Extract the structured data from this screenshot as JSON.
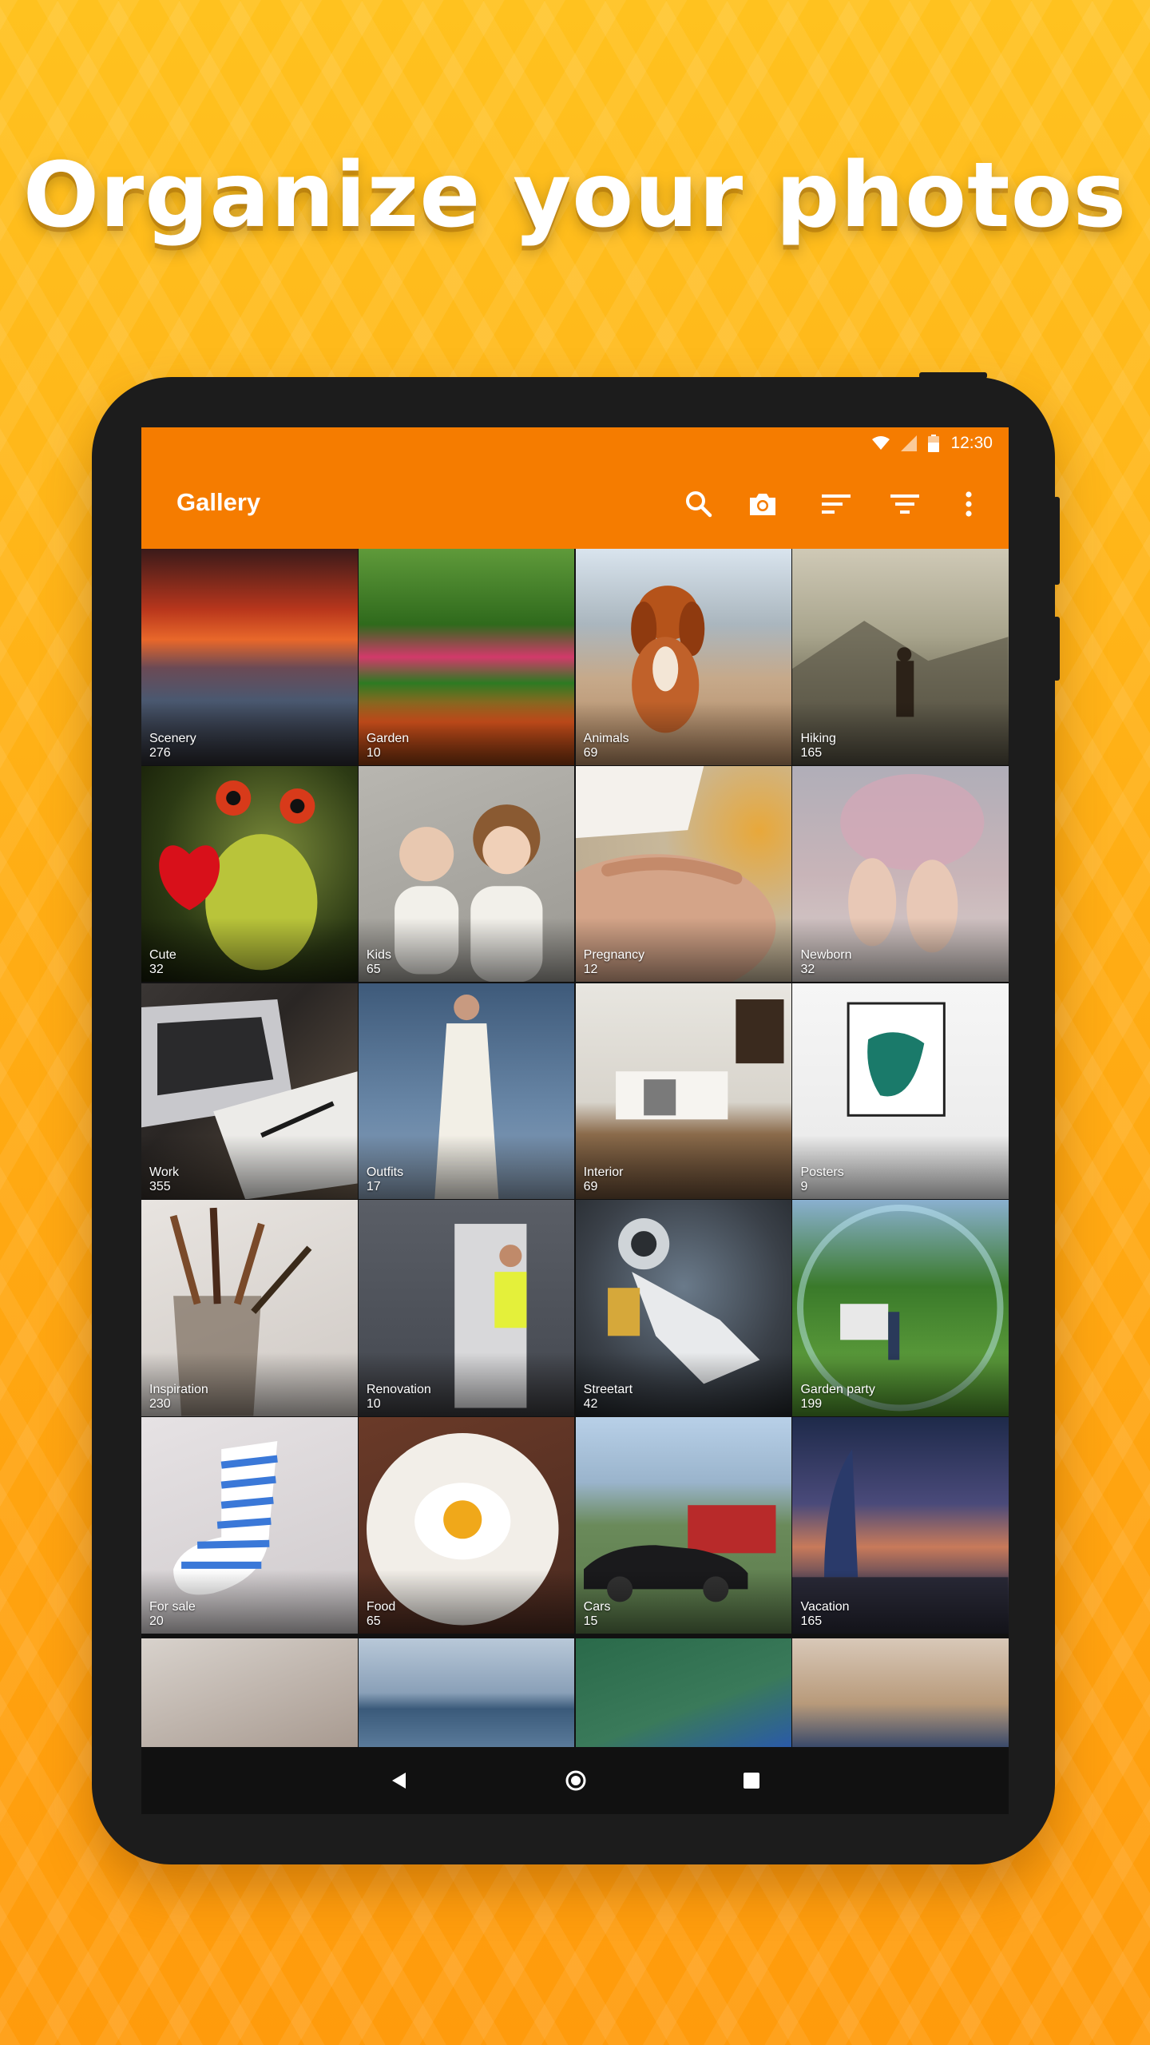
{
  "headline": "Organize your photos",
  "status": {
    "time": "12:30"
  },
  "toolbar": {
    "title": "Gallery",
    "icons": [
      "search-icon",
      "camera-icon",
      "sort-icon",
      "filter-icon",
      "more-vert-icon"
    ]
  },
  "colors": {
    "accent": "#f57c00",
    "background": "#ffb21a"
  },
  "albums": [
    {
      "name": "Scenery",
      "count": "276"
    },
    {
      "name": "Garden",
      "count": "10"
    },
    {
      "name": "Animals",
      "count": "69"
    },
    {
      "name": "Hiking",
      "count": "165"
    },
    {
      "name": "Cute",
      "count": "32"
    },
    {
      "name": "Kids",
      "count": "65"
    },
    {
      "name": "Pregnancy",
      "count": "12"
    },
    {
      "name": "Newborn",
      "count": "32"
    },
    {
      "name": "Work",
      "count": "355"
    },
    {
      "name": "Outfits",
      "count": "17"
    },
    {
      "name": "Interior",
      "count": "69"
    },
    {
      "name": "Posters",
      "count": "9"
    },
    {
      "name": "Inspiration",
      "count": "230"
    },
    {
      "name": "Renovation",
      "count": "10"
    },
    {
      "name": "Streetart",
      "count": "42"
    },
    {
      "name": "Garden party",
      "count": "199"
    },
    {
      "name": "For sale",
      "count": "20"
    },
    {
      "name": "Food",
      "count": "65"
    },
    {
      "name": "Cars",
      "count": "15"
    },
    {
      "name": "Vacation",
      "count": "165"
    }
  ],
  "navbar": [
    "back-icon",
    "home-icon",
    "recents-icon"
  ]
}
